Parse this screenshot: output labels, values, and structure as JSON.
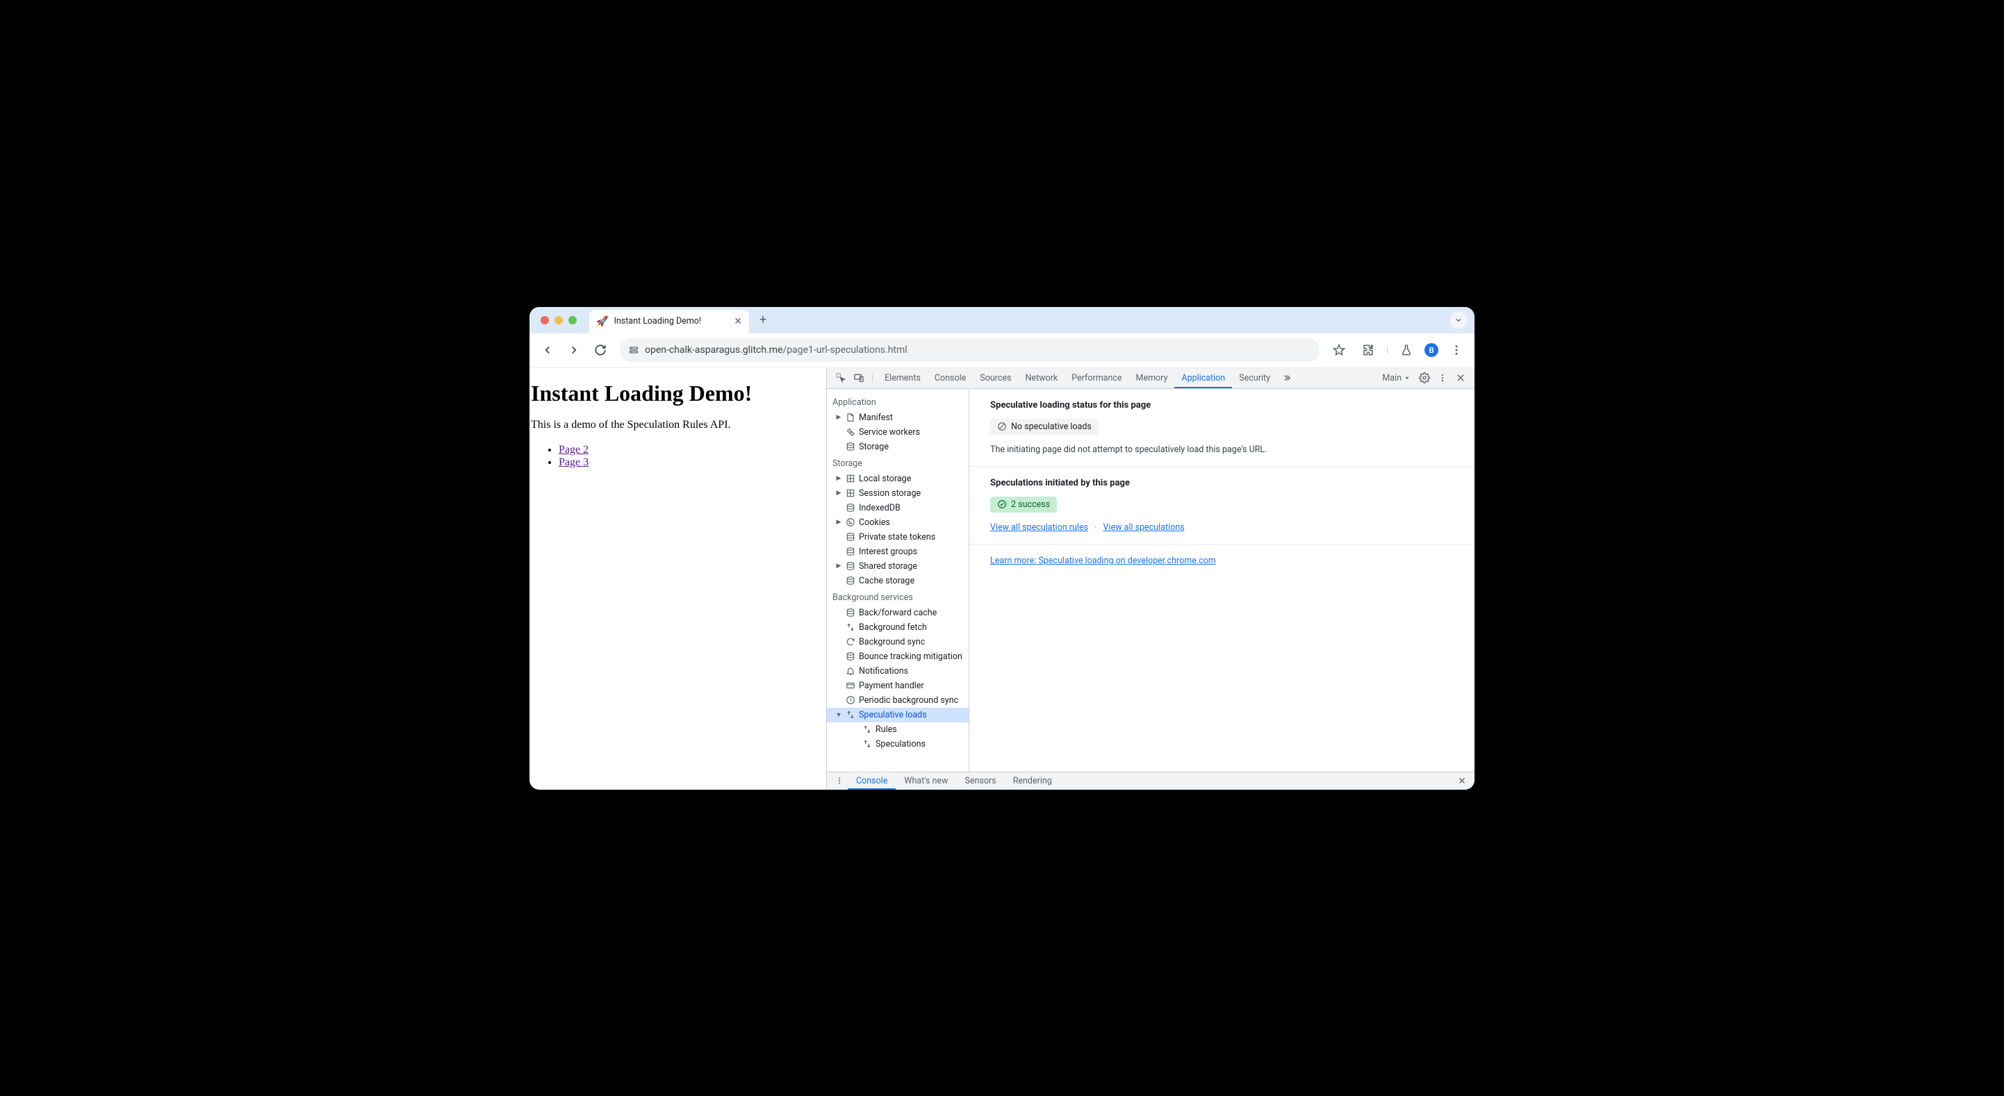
{
  "browser": {
    "tab_title": "Instant Loading Demo!",
    "favicon": "🚀",
    "url_host": "open-chalk-asparagus.glitch.me",
    "url_path": "/page1-url-speculations.html",
    "avatar_letter": "B"
  },
  "page": {
    "heading": "Instant Loading Demo!",
    "intro": "This is a demo of the Speculation Rules API.",
    "links": [
      "Page 2",
      "Page 3"
    ]
  },
  "devtools": {
    "tabs": [
      "Elements",
      "Console",
      "Sources",
      "Network",
      "Performance",
      "Memory",
      "Application",
      "Security"
    ],
    "active_tab": "Application",
    "target": "Main",
    "sidebar": {
      "application": {
        "title": "Application",
        "items": [
          {
            "label": "Manifest",
            "icon": "file",
            "expandable": true
          },
          {
            "label": "Service workers",
            "icon": "gear"
          },
          {
            "label": "Storage",
            "icon": "db"
          }
        ]
      },
      "storage": {
        "title": "Storage",
        "items": [
          {
            "label": "Local storage",
            "icon": "grid",
            "expandable": true
          },
          {
            "label": "Session storage",
            "icon": "grid",
            "expandable": true
          },
          {
            "label": "IndexedDB",
            "icon": "db"
          },
          {
            "label": "Cookies",
            "icon": "cookie",
            "expandable": true
          },
          {
            "label": "Private state tokens",
            "icon": "db"
          },
          {
            "label": "Interest groups",
            "icon": "db"
          },
          {
            "label": "Shared storage",
            "icon": "db",
            "expandable": true
          },
          {
            "label": "Cache storage",
            "icon": "db"
          }
        ]
      },
      "background": {
        "title": "Background services",
        "items": [
          {
            "label": "Back/forward cache",
            "icon": "db"
          },
          {
            "label": "Background fetch",
            "icon": "arrows"
          },
          {
            "label": "Background sync",
            "icon": "sync"
          },
          {
            "label": "Bounce tracking mitigation",
            "icon": "db"
          },
          {
            "label": "Notifications",
            "icon": "bell"
          },
          {
            "label": "Payment handler",
            "icon": "card"
          },
          {
            "label": "Periodic background sync",
            "icon": "clock"
          },
          {
            "label": "Speculative loads",
            "icon": "arrows",
            "expandable": true,
            "expanded": true,
            "selected": true
          },
          {
            "label": "Rules",
            "icon": "arrows",
            "nested": true
          },
          {
            "label": "Speculations",
            "icon": "arrows",
            "nested": true
          }
        ]
      }
    },
    "content": {
      "status_title": "Speculative loading status for this page",
      "status_badge": "No speculative loads",
      "status_desc": "The initiating page did not attempt to speculatively load this page's URL.",
      "initiated_title": "Speculations initiated by this page",
      "initiated_badge": "2 success",
      "link_rules": "View all speculation rules",
      "link_specs": "View all speculations",
      "learn_more": "Learn more: Speculative loading on developer.chrome.com"
    },
    "drawer": {
      "tabs": [
        "Console",
        "What's new",
        "Sensors",
        "Rendering"
      ],
      "active": "Console"
    }
  }
}
